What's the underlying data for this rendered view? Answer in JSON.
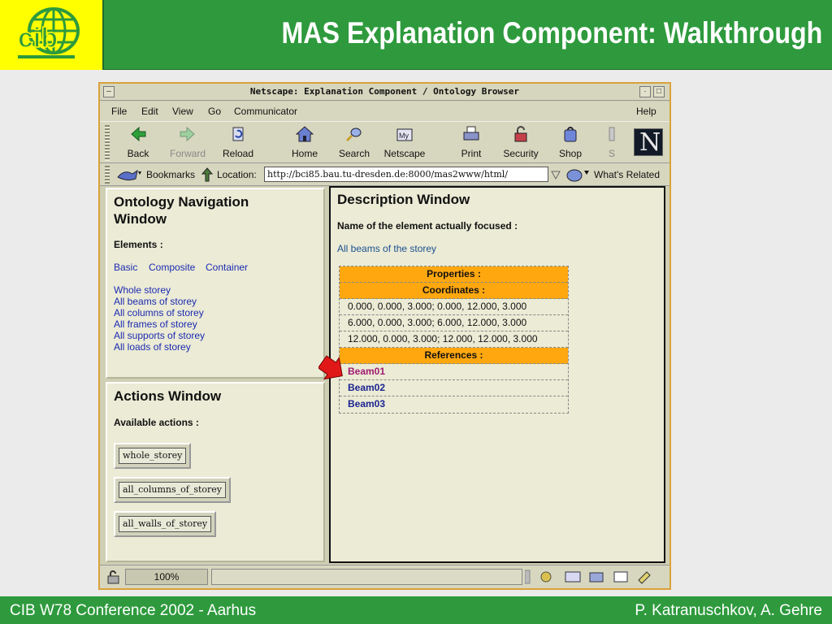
{
  "slide": {
    "title": "MAS Explanation Component: Walkthrough",
    "footer_left": "CIB W78 Conference 2002 - Aarhus",
    "footer_right": "P. Katranuschkov, A. Gehre",
    "logo_text": "cib",
    "colors": {
      "header_green": "#2e9a3d",
      "logo_yellow": "#ffff00",
      "orange_header": "#ffa70f"
    }
  },
  "browser": {
    "window_title": "Netscape: Explanation Component / Ontology Browser",
    "menu": [
      "File",
      "Edit",
      "View",
      "Go",
      "Communicator"
    ],
    "menu_help": "Help",
    "toolbar": [
      {
        "label": "Back",
        "icon": "back-arrow-icon"
      },
      {
        "label": "Forward",
        "icon": "forward-arrow-icon",
        "disabled": true
      },
      {
        "label": "Reload",
        "icon": "reload-icon"
      },
      {
        "label": "Home",
        "icon": "home-icon"
      },
      {
        "label": "Search",
        "icon": "search-icon"
      },
      {
        "label": "Netscape",
        "icon": "netscape-icon"
      },
      {
        "label": "Print",
        "icon": "print-icon"
      },
      {
        "label": "Security",
        "icon": "security-lock-icon"
      },
      {
        "label": "Shop",
        "icon": "shop-bag-icon"
      },
      {
        "label": "S",
        "icon": "stop-icon"
      }
    ],
    "netscape_logo": "N",
    "location": {
      "bookmarks": "Bookmarks",
      "label": "Location:",
      "url": "http://bci85.bau.tu-dresden.de:8000/mas2www/html/",
      "whats_related": "What's Related"
    },
    "status": {
      "progress": "100%"
    }
  },
  "nav": {
    "title": "Ontology Navigation Window",
    "elements_label": "Elements :",
    "tabs": [
      "Basic",
      "Composite",
      "Container"
    ],
    "items": [
      "Whole storey",
      "All beams of storey",
      "All columns of storey",
      "All frames of storey",
      "All supports of storey",
      "All loads of storey"
    ]
  },
  "actions": {
    "title": "Actions Window",
    "available_label": "Available actions :",
    "buttons": [
      "whole_storey",
      "all_columns_of_storey",
      "all_walls_of_storey"
    ]
  },
  "description": {
    "title": "Description Window",
    "focus_label": "Name of the element actually focused :",
    "focused": "All beams of the storey",
    "properties_header": "Properties :",
    "coordinates_header": "Coordinates :",
    "coordinates": [
      "0.000, 0.000, 3.000; 0.000, 12.000, 3.000",
      "6.000, 0.000, 3.000; 6.000, 12.000, 3.000",
      "12.000, 0.000, 3.000; 12.000, 12.000, 3.000"
    ],
    "references_header": "References :",
    "references": [
      "Beam01",
      "Beam02",
      "Beam03"
    ]
  }
}
